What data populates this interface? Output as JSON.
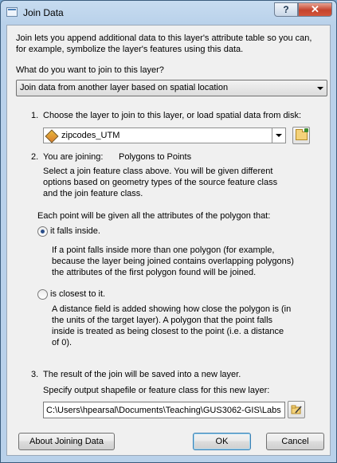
{
  "window": {
    "title": "Join Data"
  },
  "intro": {
    "line1": "Join lets you append additional data to this layer's attribute table so you can,",
    "line2": "for example, symbolize the layer's features using this data."
  },
  "join_type": {
    "question": "What do you want to join to this layer?",
    "selected": "Join data from another layer based on spatial location"
  },
  "step1": {
    "number": "1.",
    "label": "Choose the layer to join to this layer, or load spatial data from disk:",
    "layer_selected": "zipcodes_UTM"
  },
  "step2": {
    "number": "2.",
    "label": "You are joining:",
    "value": "Polygons to Points",
    "description": [
      "Select a join feature class above.  You will be given different",
      "options based on geometry types of the source feature class",
      "and the join feature class."
    ]
  },
  "point_options": {
    "heading": "Each point will be given all the attributes of the polygon that:",
    "option1": {
      "label": "it falls inside.",
      "description": [
        "If a point falls inside more than one polygon (for example,",
        "because the layer being joined contains overlapping polygons)",
        "the attributes of the first polygon found will be joined."
      ],
      "selected": true
    },
    "option2": {
      "label": "is closest to it.",
      "description": [
        "A distance field is added showing how close the polygon is (in",
        "the units of the target layer).  A polygon that the point falls",
        "inside is treated as being closest to the point (i.e. a distance",
        "of 0)."
      ],
      "selected": false
    }
  },
  "step3": {
    "number": "3.",
    "label": "The result of the join will be saved into a new layer.",
    "sub_label": "Specify output shapefile or feature class for this new layer:",
    "output_path": "C:\\Users\\hpearsal\\Documents\\Teaching\\GUS3062-GIS\\Labs"
  },
  "buttons": {
    "about": "About Joining Data",
    "ok": "OK",
    "cancel": "Cancel"
  },
  "icons": {
    "browse": "folder-open-icon",
    "edit": "folder-edit-icon",
    "layer": "polygon-layer-icon"
  }
}
